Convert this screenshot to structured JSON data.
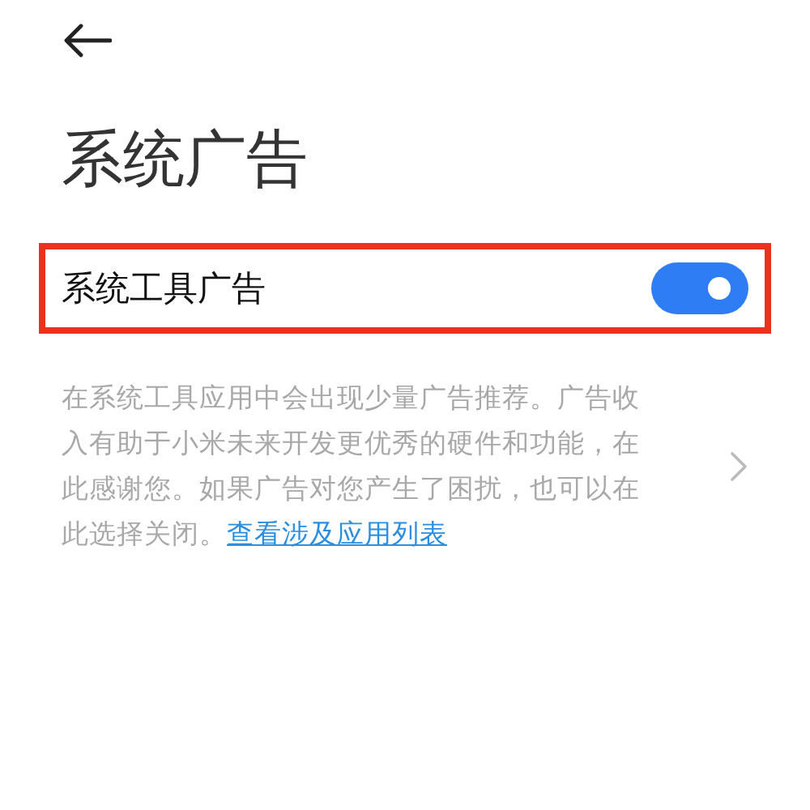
{
  "header": {
    "title": "系统广告"
  },
  "setting": {
    "label": "系统工具广告",
    "on": true
  },
  "description": {
    "text": "在系统工具应用中会出现少量广告推荐。广告收入有助于小米未来开发更优秀的硬件和功能，在此感谢您。如果广告对您产生了困扰，也可以在此选择关闭。",
    "link": "查看涉及应用列表"
  }
}
